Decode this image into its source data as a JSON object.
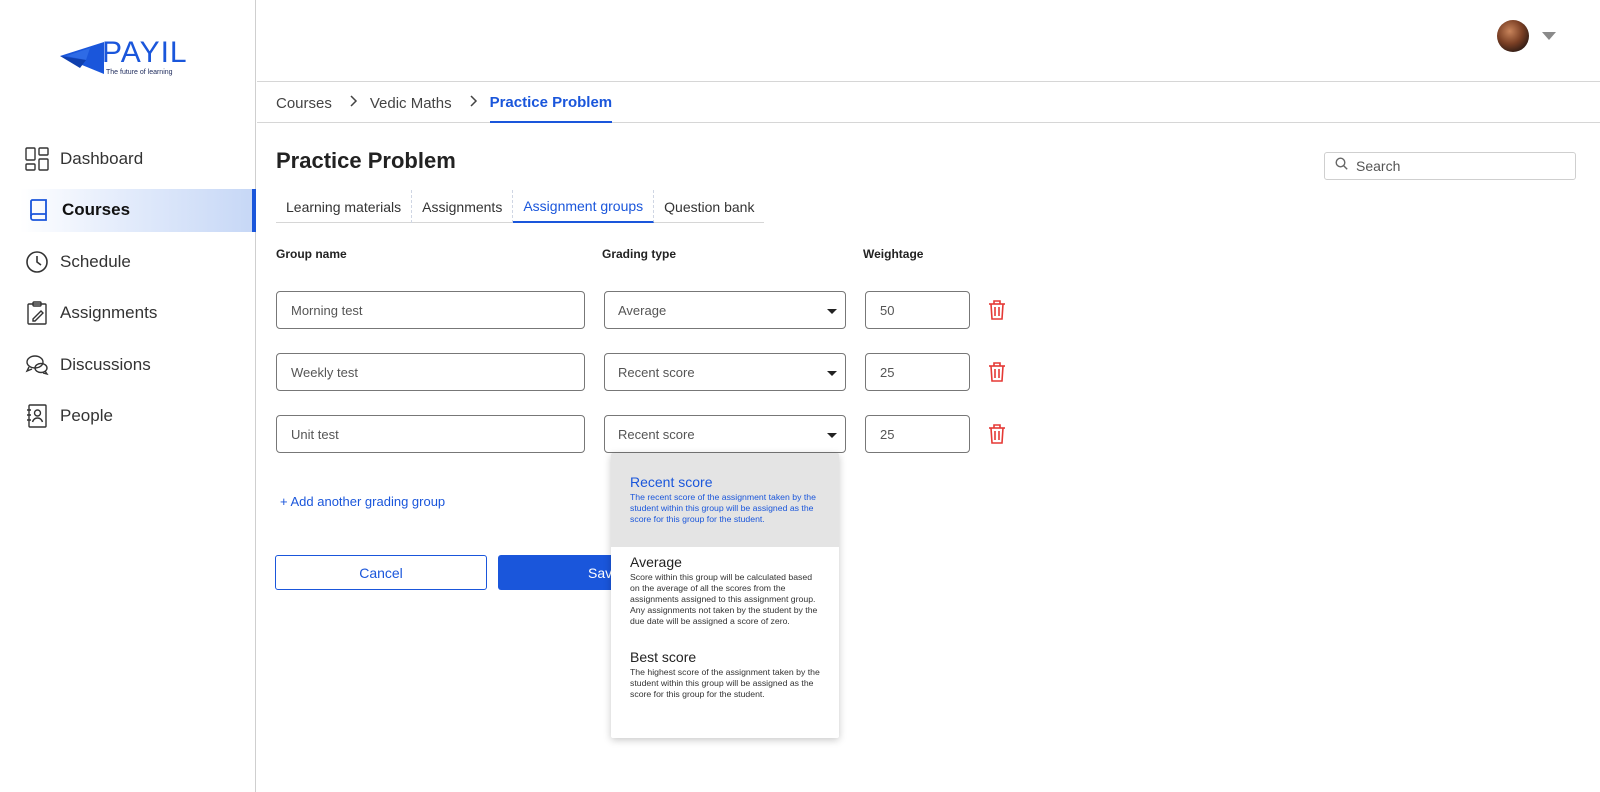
{
  "brand": {
    "name": "PAYIL",
    "tagline": "The future of learning",
    "color": "#1a56db"
  },
  "sidebar": {
    "items": [
      {
        "label": "Dashboard",
        "icon": "dashboard-icon"
      },
      {
        "label": "Courses",
        "icon": "book-icon",
        "active": true
      },
      {
        "label": "Schedule",
        "icon": "clock-icon"
      },
      {
        "label": "Assignments",
        "icon": "clipboard-icon"
      },
      {
        "label": "Discussions",
        "icon": "chat-icon"
      },
      {
        "label": "People",
        "icon": "contacts-icon"
      }
    ]
  },
  "header": {
    "avatar": "user-avatar",
    "menu_icon": "caret-down-icon"
  },
  "breadcrumb": [
    "Courses",
    "Vedic Maths",
    "Practice Problem"
  ],
  "page": {
    "title": "Practice Problem"
  },
  "search": {
    "placeholder": "Search"
  },
  "tabs": [
    {
      "label": "Learning materials"
    },
    {
      "label": "Assignments"
    },
    {
      "label": "Assignment groups",
      "active": true
    },
    {
      "label": "Question bank"
    }
  ],
  "form": {
    "columns": {
      "group_name": "Group name",
      "grading_type": "Grading type",
      "weightage": "Weightage"
    },
    "rows": [
      {
        "group_name": "Morning test",
        "grading_type": "Average",
        "weightage": "50"
      },
      {
        "group_name": "Weekly test",
        "grading_type": "Recent score",
        "weightage": "25"
      },
      {
        "group_name": "Unit test",
        "grading_type": "Recent score",
        "weightage": "25"
      }
    ],
    "add_link": "+ Add another grading group",
    "cancel_label": "Cancel",
    "save_label": "Save"
  },
  "dropdown": {
    "options": [
      {
        "title": "Recent score",
        "description": "The recent score of the assignment taken by the student within this group will be assigned as the score for this group for the student."
      },
      {
        "title": "Average",
        "description": "Score within this group will be calculated based on the average of all the scores from the assignments assigned to this assignment group. Any assignments not taken by the student by the due date will be assigned a score of zero."
      },
      {
        "title": "Best score",
        "description": "The highest score of the assignment taken by the student within this group will be assigned as the score for this group for the student."
      }
    ]
  },
  "colors": {
    "accent": "#1a56db",
    "danger": "#e53935"
  }
}
